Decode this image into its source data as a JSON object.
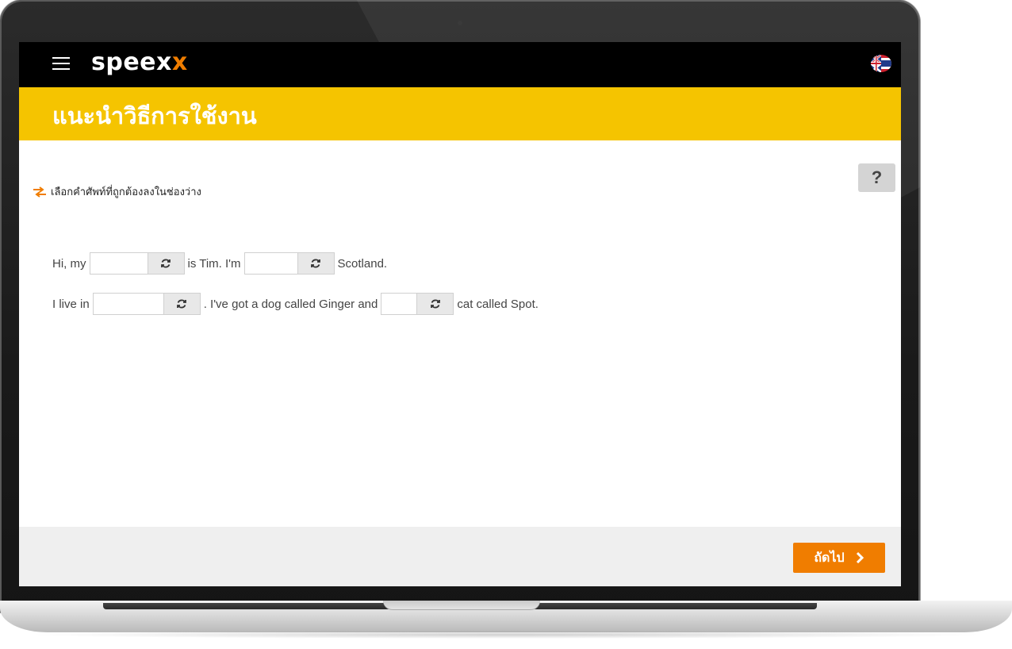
{
  "app": {
    "logo_main": "speex",
    "logo_accent": "x",
    "language_flag": "uk-flag-icon"
  },
  "banner": {
    "title": "แนะนำวิธีการใช้งาน"
  },
  "exercise": {
    "instruction": "เลือกคำศัพท์ที่ถูกต้องลงในช่องว่าง",
    "help_label": "?",
    "line1": {
      "t1": "Hi, my",
      "t2": "is Tim. I'm",
      "t3": "Scotland."
    },
    "line2": {
      "t1": "I live in",
      "t2": ". I've got a dog called Ginger and",
      "t3": "cat called Spot."
    },
    "gaps": [
      "",
      "",
      "",
      ""
    ]
  },
  "footer": {
    "next_label": "ถัดไป"
  },
  "colors": {
    "brand_orange": "#f07d00",
    "banner_yellow": "#f5c400",
    "topbar": "#000000",
    "footer_bg": "#efefef"
  }
}
